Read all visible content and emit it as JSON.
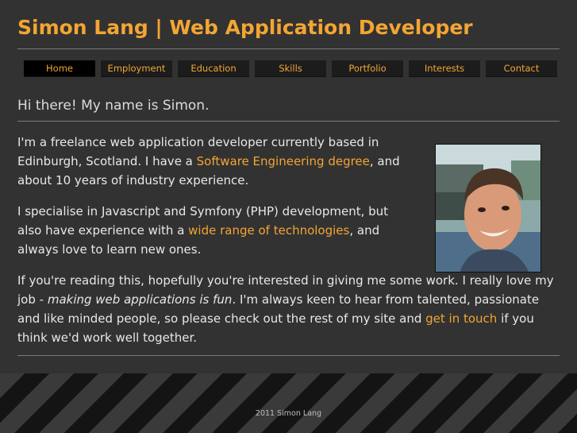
{
  "header": {
    "title": "Simon Lang | Web Application Developer"
  },
  "nav": {
    "items": [
      {
        "label": "Home",
        "active": true
      },
      {
        "label": "Employment"
      },
      {
        "label": "Education"
      },
      {
        "label": "Skills"
      },
      {
        "label": "Portfolio"
      },
      {
        "label": "Interests"
      },
      {
        "label": "Contact"
      }
    ]
  },
  "main": {
    "heading": "Hi there! My name is Simon.",
    "p1": {
      "before": "I'm a freelance web application developer currently based in Edinburgh, Scotland. I have a ",
      "link": "Software Engineering degree",
      "after": ", and about 10 years of industry experience."
    },
    "p2": {
      "before": "I specialise in Javascript and Symfony (PHP) development, but also have experience with a ",
      "link": "wide range of technologies",
      "after": ", and always love to learn new ones."
    },
    "p3": {
      "before": "If you're reading this, hopefully you're interested in giving me some work. I really love my job - ",
      "emphasis": "making web applications is fun",
      "middle": ". I'm always keen to hear from talented, passionate and like minded people, so please check out the rest of my site and ",
      "link": "get in touch",
      "after": " if you think we'd work well together."
    }
  },
  "footer": {
    "text": "2011 Simon Lang"
  },
  "colors": {
    "accent": "#f3a533",
    "background": "#323232",
    "nav_bg": "#1c1c1c",
    "nav_active": "#000000"
  }
}
